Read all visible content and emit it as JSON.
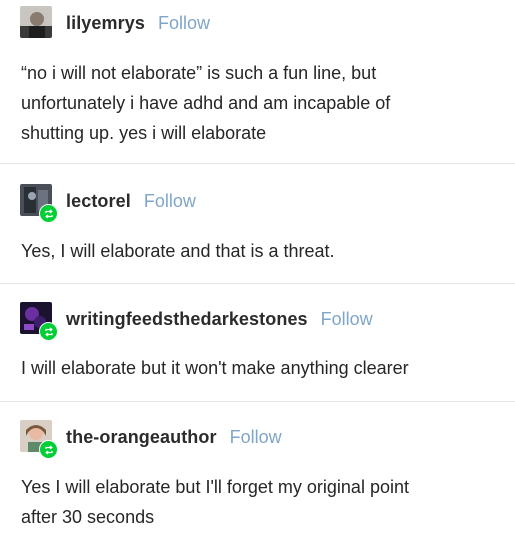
{
  "posts": [
    {
      "username": "lilyemrys",
      "follow_label": "Follow",
      "reblog": false,
      "lines": [
        "“no i will not elaborate” is such a fun line, but",
        "unfortunately i have adhd and am incapable of",
        "shutting up. yes i will elaborate"
      ]
    },
    {
      "username": "lectorel",
      "follow_label": "Follow",
      "reblog": true,
      "lines": [
        "Yes, I will elaborate and that is a threat."
      ]
    },
    {
      "username": "writingfeedsthedarkestones",
      "follow_label": "Follow",
      "reblog": true,
      "lines": [
        "I will elaborate but it won't make anything clearer"
      ]
    },
    {
      "username": "the-orangeauthor",
      "follow_label": "Follow",
      "reblog": true,
      "lines": [
        "Yes I will elaborate but I'll forget my original point",
        "after 30 seconds"
      ]
    }
  ],
  "colors": {
    "follow": "#7fa6c8",
    "reblog_badge": "#00cf35",
    "divider": "#e6e6e6"
  }
}
